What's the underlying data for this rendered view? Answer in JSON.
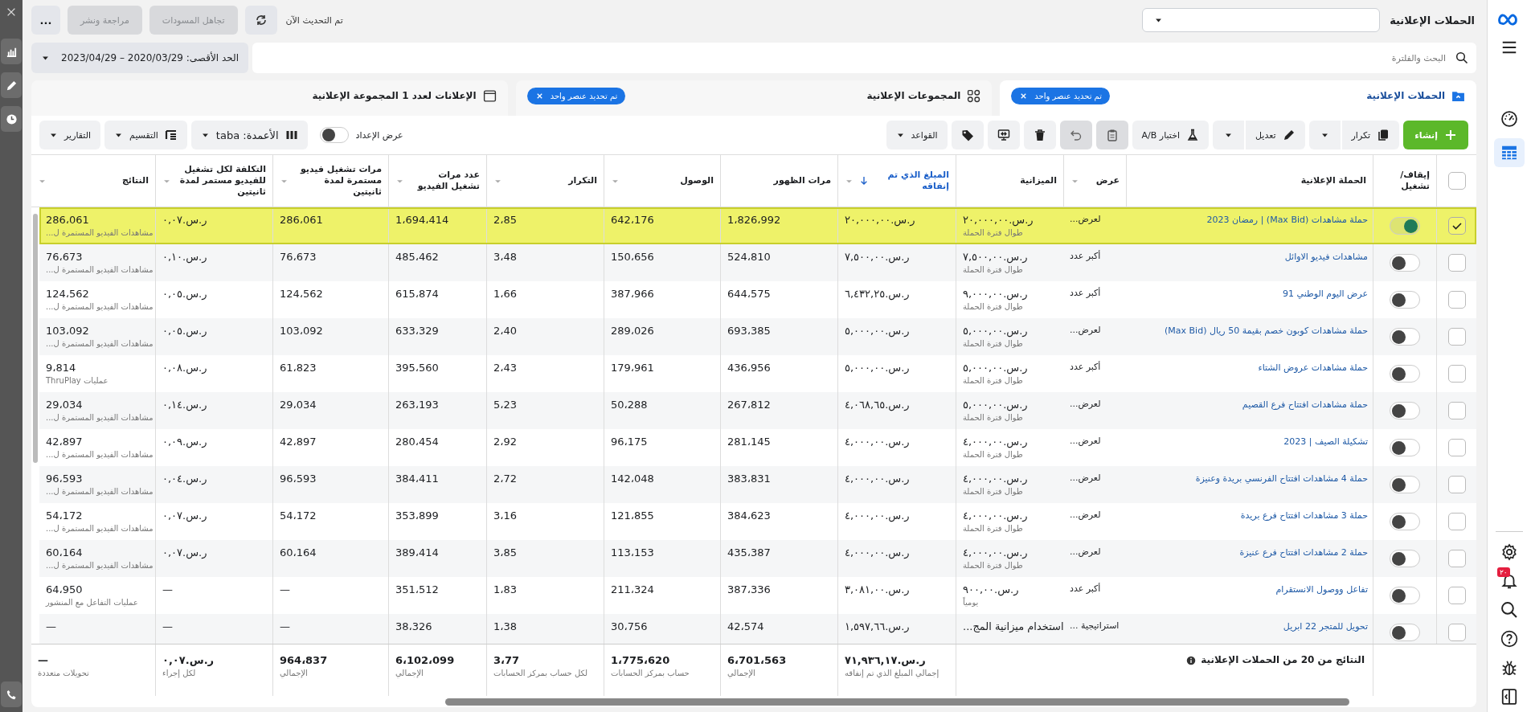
{
  "top_bar": {
    "title": "الحملات الإعلانية",
    "status": "تم التحديث الآن",
    "buttons": [
      {
        "kind": "refresh",
        "disabled": false
      },
      {
        "kind": "text",
        "label": "تجاهل المسودات",
        "disabled": true
      },
      {
        "kind": "text",
        "label": "مراجعة ونشر",
        "disabled": true
      },
      {
        "kind": "more",
        "label": "...",
        "disabled": false
      }
    ]
  },
  "search": {
    "placeholder": "البحث والفلترة"
  },
  "date_range": {
    "label": "الحد الأقصى: 2020/03/29 – 2023/04/29"
  },
  "tabs": [
    {
      "kind": "campaigns",
      "label": "الحملات الإعلانية",
      "selected": true,
      "chip": "تم تحديد عنصر واحد"
    },
    {
      "kind": "ad_sets",
      "label": "المجموعات الإعلانية",
      "selected": false,
      "chip": "تم تحديد عنصر واحد"
    },
    {
      "kind": "ads",
      "label": "الإعلانات لعدد **1** المجموعة الإعلانية",
      "selected": false
    }
  ],
  "toolbar": [
    {
      "kind": "create",
      "label": "إنشاء",
      "split": false,
      "disabled": false,
      "caret": false
    },
    {
      "kind": "duplicate",
      "label": "تكرار",
      "split": true,
      "disabled": false,
      "caret": false
    },
    {
      "kind": "edit",
      "label": "تعديل",
      "split": true,
      "disabled": false,
      "caret": false
    },
    {
      "kind": "ab_test",
      "label": "اختبار A/B",
      "split": false,
      "disabled": false,
      "caret": false
    },
    {
      "kind": "clipboard",
      "split": false,
      "disabled": true,
      "caret": false
    },
    {
      "kind": "undo",
      "split": false,
      "disabled": true,
      "caret": false
    },
    {
      "kind": "delete",
      "split": false,
      "disabled": false,
      "caret": false
    },
    {
      "kind": "export",
      "split": false,
      "disabled": false,
      "caret": false
    },
    {
      "kind": "tag",
      "split": false,
      "disabled": false,
      "caret": false
    },
    {
      "kind": "rules",
      "label": "القواعد",
      "split": false,
      "disabled": false,
      "caret": true
    }
  ],
  "setup_view": {
    "label": "عرض الإعداد",
    "on": false
  },
  "view_buttons": [
    {
      "kind": "columns",
      "label": "الأعمدة: taba"
    },
    {
      "kind": "breakdown",
      "label": "التقسيم"
    },
    {
      "kind": "reports",
      "label": "التقارير"
    }
  ],
  "table": {
    "select_all": {
      "checked": false
    },
    "columns": [
      {
        "label": "إيقاف/ تشغيل",
        "menu": false,
        "sorted": false
      },
      {
        "label": "الحملة الإعلانية",
        "menu": false,
        "sorted": false
      },
      {
        "label": "عرض",
        "menu": true,
        "sorted": false
      },
      {
        "label": "الميزانية",
        "menu": false,
        "sorted": false
      },
      {
        "label": "المبلغ الذي تم إنفاقه",
        "menu": true,
        "sorted": true
      },
      {
        "label": "مرات الظهور",
        "menu": false,
        "sorted": false
      },
      {
        "label": "الوصول",
        "menu": true,
        "sorted": false
      },
      {
        "label": "التكرار",
        "menu": true,
        "sorted": false
      },
      {
        "label": "عدد مرات تشغيل الفيديو",
        "menu": true,
        "sorted": false
      },
      {
        "label": "مرات تشغيل فيديو مستمرة لمدة ثانيتين",
        "menu": true,
        "sorted": false
      },
      {
        "label": "التكلفة لكل تشغيل للفيديو مستمر لمدة ثانيتين",
        "menu": true,
        "sorted": false
      },
      {
        "label": "النتائج",
        "menu": true,
        "sorted": false
      }
    ],
    "rows": [
      {
        "selected": true,
        "on": true,
        "name": "حملة مشاهدات (Max Bid) | رمضان 2023",
        "offer": "لعرض...",
        "metrics": [
          {
            "value": "ر.س.٢٠,٠٠٠,٠٠",
            "note": "طوال فترة الحملة"
          },
          {
            "value": "ر.س.٢٠,٠٠٠,٠٠"
          },
          {
            "value": "1،826،992"
          },
          {
            "value": "642،176"
          },
          {
            "value": "2،85"
          },
          {
            "value": "1،694،414"
          },
          {
            "value": "286،061"
          },
          {
            "value": "ر.س.٠,٠٧"
          },
          {
            "value": "286،061",
            "note": "مشاهدات الفيديو المستمرة ل..."
          }
        ]
      },
      {
        "selected": false,
        "on": false,
        "name": "مشاهدات فيديو الاوائل",
        "offer": "أكبر عدد",
        "metrics": [
          {
            "value": "ر.س.٧,٥٠٠,٠٠",
            "note": "طوال فترة الحملة"
          },
          {
            "value": "ر.س.٧,٥٠٠,٠٠"
          },
          {
            "value": "524،810"
          },
          {
            "value": "150،656"
          },
          {
            "value": "3،48"
          },
          {
            "value": "485،462"
          },
          {
            "value": "76،673"
          },
          {
            "value": "ر.س.٠,١٠"
          },
          {
            "value": "76،673",
            "note": "مشاهدات الفيديو المستمرة ل..."
          }
        ]
      },
      {
        "selected": false,
        "on": false,
        "name": "عرض اليوم الوطني 91",
        "offer": "أكبر عدد",
        "metrics": [
          {
            "value": "ر.س.٩,٠٠٠,٠٠",
            "note": "طوال فترة الحملة"
          },
          {
            "value": "ر.س.٦,٤٣٢,٢٥"
          },
          {
            "value": "644،575"
          },
          {
            "value": "387،966"
          },
          {
            "value": "1،66"
          },
          {
            "value": "615،874"
          },
          {
            "value": "124،562"
          },
          {
            "value": "ر.س.٠,٠٥"
          },
          {
            "value": "124،562",
            "note": "مشاهدات الفيديو المستمرة ل..."
          }
        ]
      },
      {
        "selected": false,
        "on": false,
        "name": "حملة مشاهدات كوبون خصم بقيمة 50 ريال (Max Bid)",
        "offer": "لعرض...",
        "metrics": [
          {
            "value": "ر.س.٥,٠٠٠,٠٠",
            "note": "طوال فترة الحملة"
          },
          {
            "value": "ر.س.٥,٠٠٠,٠٠"
          },
          {
            "value": "693،385"
          },
          {
            "value": "289،026"
          },
          {
            "value": "2،40"
          },
          {
            "value": "633،329"
          },
          {
            "value": "103،092"
          },
          {
            "value": "ر.س.٠,٠٥"
          },
          {
            "value": "103،092",
            "note": "مشاهدات الفيديو المستمرة ل..."
          }
        ]
      },
      {
        "selected": false,
        "on": false,
        "name": "حملة مشاهدات عروض الشتاء",
        "offer": "أكبر عدد",
        "metrics": [
          {
            "value": "ر.س.٥,٠٠٠,٠٠",
            "note": "طوال فترة الحملة"
          },
          {
            "value": "ر.س.٥,٠٠٠,٠٠"
          },
          {
            "value": "436،956"
          },
          {
            "value": "179،961"
          },
          {
            "value": "2،43"
          },
          {
            "value": "395،560"
          },
          {
            "value": "61،823"
          },
          {
            "value": "ر.س.٠,٠٨"
          },
          {
            "value": "9،814",
            "note": "عمليات ThruPlay"
          }
        ]
      },
      {
        "selected": false,
        "on": false,
        "name": "حملة مشاهدات افتتاح فرع القصيم",
        "offer": "لعرض...",
        "metrics": [
          {
            "value": "ر.س.٥,٠٠٠,٠٠",
            "note": "طوال فترة الحملة"
          },
          {
            "value": "ر.س.٤,٠٦٨,٦٥"
          },
          {
            "value": "267،812"
          },
          {
            "value": "50،288"
          },
          {
            "value": "5،23"
          },
          {
            "value": "263،193"
          },
          {
            "value": "29،034"
          },
          {
            "value": "ر.س.٠,١٤"
          },
          {
            "value": "29،034",
            "note": "مشاهدات الفيديو المستمرة ل..."
          }
        ]
      },
      {
        "selected": false,
        "on": false,
        "name": "تشكيلة الصيف | 2023",
        "offer": "لعرض...",
        "metrics": [
          {
            "value": "ر.س.٤,٠٠٠,٠٠",
            "note": "طوال فترة الحملة"
          },
          {
            "value": "ر.س.٤,٠٠٠,٠٠"
          },
          {
            "value": "281،145"
          },
          {
            "value": "96،175"
          },
          {
            "value": "2،92"
          },
          {
            "value": "280،454"
          },
          {
            "value": "42،897"
          },
          {
            "value": "ر.س.٠,٠٩"
          },
          {
            "value": "42،897",
            "note": "مشاهدات الفيديو المستمرة ل..."
          }
        ]
      },
      {
        "selected": false,
        "on": false,
        "name": "حملة 4 مشاهدات افتتاح الفرنسي بريدة وعنيزة",
        "offer": "لعرض...",
        "metrics": [
          {
            "value": "ر.س.٤,٠٠٠,٠٠",
            "note": "طوال فترة الحملة"
          },
          {
            "value": "ر.س.٤,٠٠٠,٠٠"
          },
          {
            "value": "383،831"
          },
          {
            "value": "142،048"
          },
          {
            "value": "2،72"
          },
          {
            "value": "384،411"
          },
          {
            "value": "96،593"
          },
          {
            "value": "ر.س.٠,٠٤"
          },
          {
            "value": "96،593",
            "note": "مشاهدات الفيديو المستمرة ل..."
          }
        ]
      },
      {
        "selected": false,
        "on": false,
        "name": "حملة 3 مشاهدات افتتاح فرع بريدة",
        "offer": "لعرض...",
        "metrics": [
          {
            "value": "ر.س.٤,٠٠٠,٠٠",
            "note": "طوال فترة الحملة"
          },
          {
            "value": "ر.س.٤,٠٠٠,٠٠"
          },
          {
            "value": "384،623"
          },
          {
            "value": "121،855"
          },
          {
            "value": "3،16"
          },
          {
            "value": "353،899"
          },
          {
            "value": "54،172"
          },
          {
            "value": "ر.س.٠,٠٧"
          },
          {
            "value": "54،172",
            "note": "مشاهدات الفيديو المستمرة ل..."
          }
        ]
      },
      {
        "selected": false,
        "on": false,
        "name": "حملة 2 مشاهدات افتتاح فرع عنيزة",
        "offer": "لعرض...",
        "metrics": [
          {
            "value": "ر.س.٤,٠٠٠,٠٠",
            "note": "طوال فترة الحملة"
          },
          {
            "value": "ر.س.٤,٠٠٠,٠٠"
          },
          {
            "value": "435،387"
          },
          {
            "value": "113،153"
          },
          {
            "value": "3،85"
          },
          {
            "value": "389،414"
          },
          {
            "value": "60،164"
          },
          {
            "value": "ر.س.٠,٠٧"
          },
          {
            "value": "60،164",
            "note": "مشاهدات الفيديو المستمرة ل..."
          }
        ]
      },
      {
        "selected": false,
        "on": false,
        "name": "تفاعل ووصول الانستقرام",
        "offer": "أكبر عدد",
        "metrics": [
          {
            "value": "ر.س.٩٠٠,٠٠",
            "note": "يومياً"
          },
          {
            "value": "ر.س.٣,٠٨١,٠٠"
          },
          {
            "value": "387،336"
          },
          {
            "value": "211،324"
          },
          {
            "value": "1،83"
          },
          {
            "value": "351،512"
          },
          {
            "value": "—"
          },
          {
            "value": "—"
          },
          {
            "value": "64،950",
            "note": "عمليات التفاعل مع المنشور"
          }
        ]
      },
      {
        "selected": false,
        "on": false,
        "name": "تحويل للمتجر 22 ابريل",
        "offer": "استراتيجية ...",
        "metrics": [
          {
            "value": "استخدام ميزانية المج..."
          },
          {
            "value": "ر.س.١,٥٩٧,٦٦"
          },
          {
            "value": "42،574"
          },
          {
            "value": "30،756"
          },
          {
            "value": "1،38"
          },
          {
            "value": "38،326"
          },
          {
            "value": "—"
          },
          {
            "value": "—"
          },
          {
            "value": "—"
          }
        ]
      }
    ],
    "footer": {
      "summary": "النتائج من 20 من الحملات الإعلانية",
      "totals": [
        {
          "value": "ر.س.٧١,٩٣٦,١٧",
          "label": "إجمالي المبلغ الذي تم إنفاقه"
        },
        {
          "value": "6،701،563",
          "label": "الإجمالي"
        },
        {
          "value": "1،775،620",
          "label": "حساب بمركز الحسابات"
        },
        {
          "value": "3،77",
          "label": "لكل حساب بمركز الحسابات"
        },
        {
          "value": "6،102،099",
          "label": "الإجمالي"
        },
        {
          "value": "964،837",
          "label": "الإجمالي"
        },
        {
          "value": "ر.س.٠,٠٧",
          "label": "لكل إجراء"
        },
        {
          "value": "—",
          "label": "تحويلات متعددة"
        }
      ]
    }
  },
  "right_nav": {
    "top": [
      {
        "kind": "gauge",
        "selected": false
      },
      {
        "kind": "table",
        "selected": true
      }
    ],
    "notification_count": "٢٠"
  }
}
